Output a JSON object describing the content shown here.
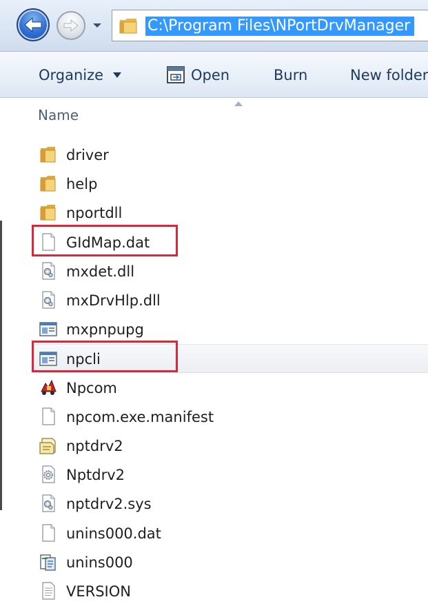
{
  "address_bar": {
    "path": "C:\\Program Files\\NPortDrvManager",
    "back_icon": "back-arrow-icon",
    "forward_icon": "forward-arrow-icon",
    "recent_icon": "chevron-down-icon"
  },
  "toolbar": {
    "organize_label": "Organize",
    "open_label": "Open",
    "burn_label": "Burn",
    "new_folder_label": "New folder"
  },
  "columns": {
    "name_label": "Name"
  },
  "files": [
    {
      "name": "driver",
      "icon": "folder-icon"
    },
    {
      "name": "help",
      "icon": "folder-icon"
    },
    {
      "name": "nportdll",
      "icon": "folder-icon"
    },
    {
      "name": "GIdMap.dat",
      "icon": "blank-file-icon",
      "highlighted": true
    },
    {
      "name": "mxdet.dll",
      "icon": "dll-file-icon"
    },
    {
      "name": "mxDrvHlp.dll",
      "icon": "dll-file-icon"
    },
    {
      "name": "mxpnpupg",
      "icon": "application-icon"
    },
    {
      "name": "npcli",
      "icon": "application-icon",
      "highlighted": true,
      "selected": true
    },
    {
      "name": "Npcom",
      "icon": "npcom-app-icon"
    },
    {
      "name": "npcom.exe.manifest",
      "icon": "blank-file-icon"
    },
    {
      "name": "nptdrv2",
      "icon": "setup-info-icon"
    },
    {
      "name": "Nptdrv2",
      "icon": "config-file-icon"
    },
    {
      "name": "nptdrv2.sys",
      "icon": "dll-file-icon"
    },
    {
      "name": "unins000.dat",
      "icon": "blank-file-icon"
    },
    {
      "name": "unins000",
      "icon": "uninstaller-icon"
    },
    {
      "name": "VERSION",
      "icon": "text-file-icon"
    }
  ],
  "colors": {
    "selection": "#3399ff",
    "highlight_box": "#d8283a",
    "command_text": "#1e395b"
  }
}
